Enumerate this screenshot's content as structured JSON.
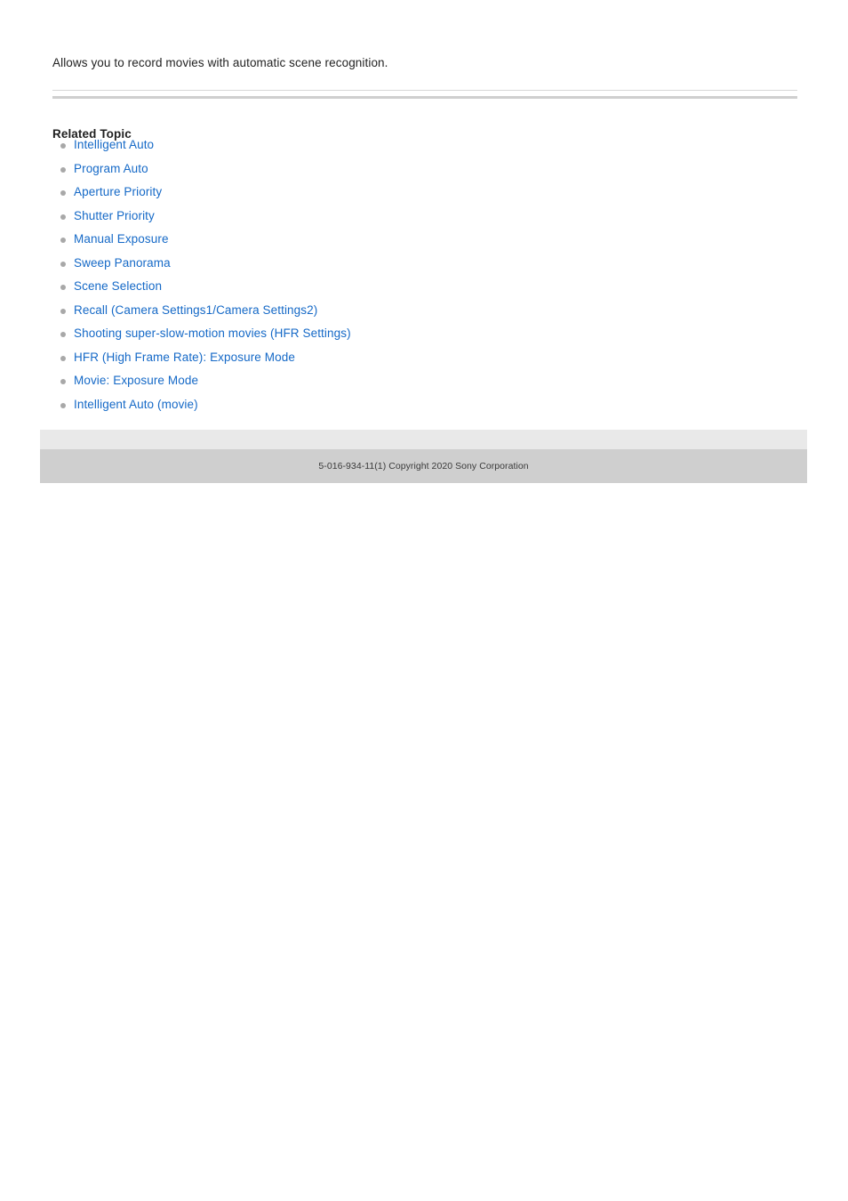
{
  "body": {
    "intro_text": "Allows you to record movies with automatic scene recognition."
  },
  "related": {
    "heading": "Related Topic",
    "bullet_icon": "bullet-dot-icon",
    "link_color": "#1569c7",
    "items": [
      {
        "label": "Intelligent Auto"
      },
      {
        "label": "Program Auto"
      },
      {
        "label": "Aperture Priority"
      },
      {
        "label": "Shutter Priority"
      },
      {
        "label": "Manual Exposure"
      },
      {
        "label": "Sweep Panorama"
      },
      {
        "label": "Scene Selection"
      },
      {
        "label": "Recall (Camera Settings1/Camera Settings2)"
      },
      {
        "label": "Shooting super-slow-motion movies (HFR Settings)"
      },
      {
        "label": "HFR (High Frame Rate): Exposure Mode"
      },
      {
        "label": "Movie: Exposure Mode"
      },
      {
        "label": "Intelligent Auto (movie)"
      }
    ]
  },
  "footer": {
    "copyright": "5-016-934-11(1) Copyright 2020 Sony Corporation",
    "top_band_color": "#e9e9e9",
    "bottom_band_color": "#cfcfcf"
  }
}
